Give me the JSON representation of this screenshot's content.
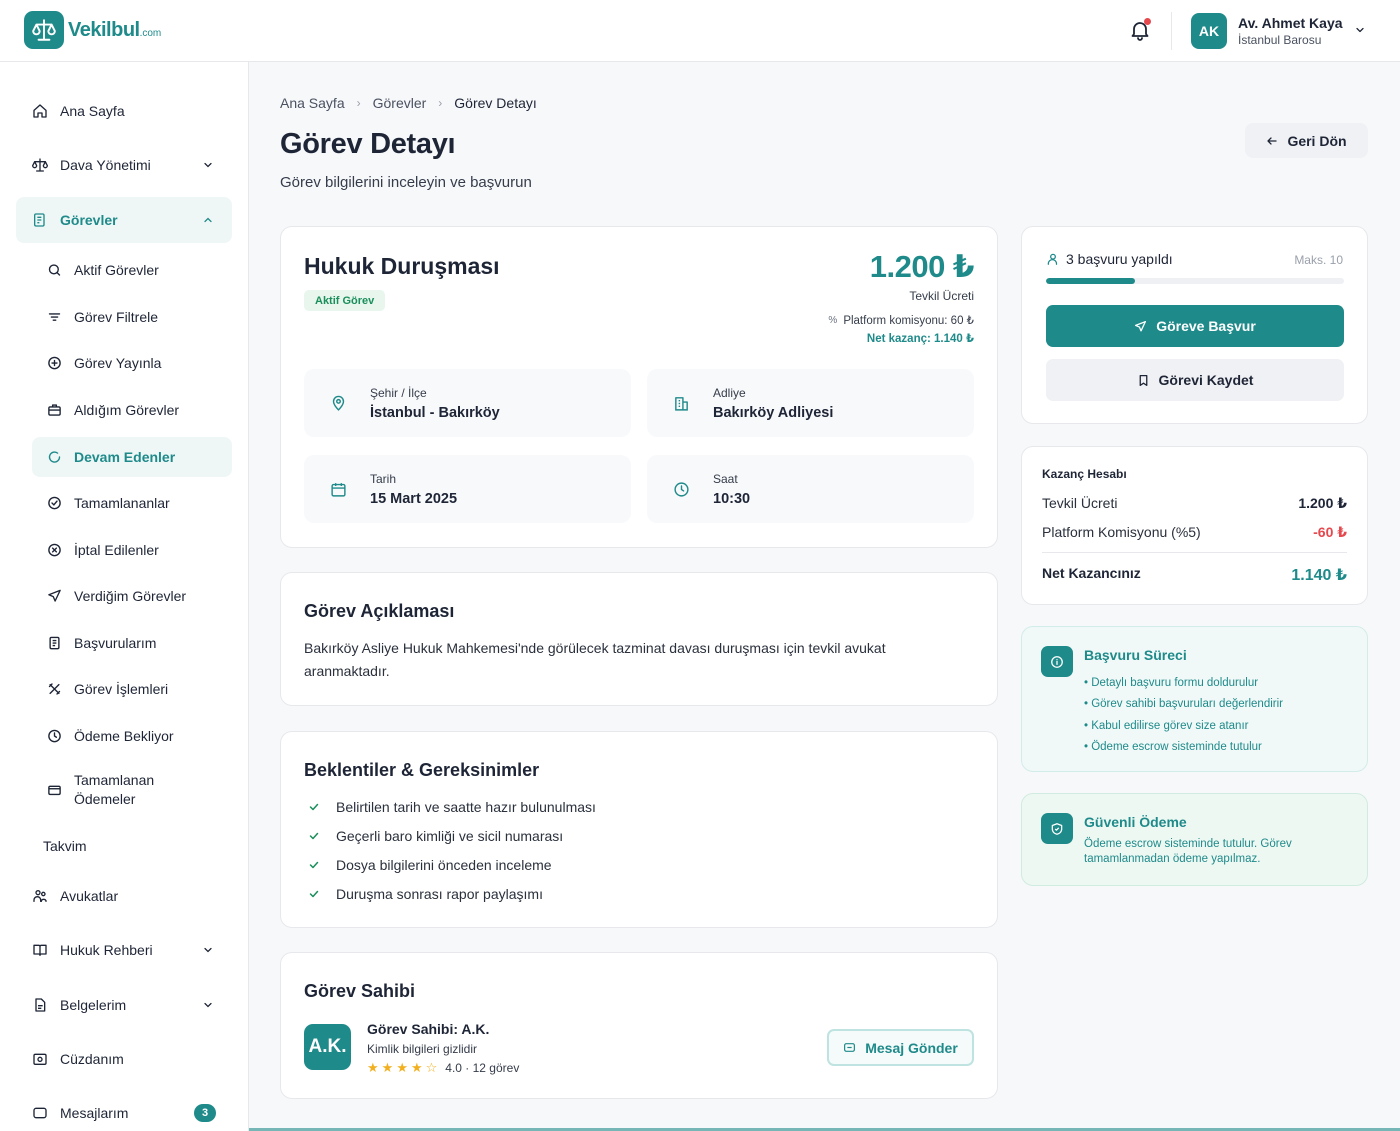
{
  "brand": {
    "name": "Vekilbul",
    "suffix": ".com"
  },
  "header": {
    "user_initials": "AK",
    "user_name": "Av. Ahmet Kaya",
    "user_org": "İstanbul Barosu"
  },
  "sidebar": {
    "items": [
      {
        "label": "Ana Sayfa"
      },
      {
        "label": "Dava Yönetimi"
      },
      {
        "label": "Görevler"
      },
      {
        "label": "Takvim"
      },
      {
        "label": "Avukatlar"
      },
      {
        "label": "Hukuk Rehberi"
      },
      {
        "label": "Belgelerim"
      },
      {
        "label": "Cüzdanım"
      },
      {
        "label": "Mesajlarım",
        "badge": "3"
      }
    ],
    "sub_items": [
      {
        "label": "Aktif Görevler"
      },
      {
        "label": "Görev Filtrele"
      },
      {
        "label": "Görev Yayınla"
      },
      {
        "label": "Aldığım Görevler"
      },
      {
        "label": "Devam Edenler"
      },
      {
        "label": "Tamamlananlar"
      },
      {
        "label": "İptal Edilenler"
      },
      {
        "label": "Verdiğim Görevler"
      },
      {
        "label": "Başvurularım"
      },
      {
        "label": "Görev İşlemleri"
      },
      {
        "label": "Ödeme Bekliyor"
      },
      {
        "label": "Tamamlanan Ödemeler"
      }
    ]
  },
  "breadcrumb": [
    "Ana Sayfa",
    "Görevler",
    "Görev Detayı"
  ],
  "page": {
    "title": "Görev Detayı",
    "subtitle": "Görev bilgilerini inceleyin ve başvurun",
    "back_label": "Geri Dön"
  },
  "job": {
    "title": "Hukuk Duruşması",
    "status": "Aktif Görev",
    "price": "1.200 ₺",
    "price_label": "Tevkil Ücreti",
    "commission": "Platform komisyonu: 60 ₺",
    "net": "Net kazanç: 1.140 ₺",
    "info": [
      {
        "key": "Şehir / İlçe",
        "value": "İstanbul - Bakırköy"
      },
      {
        "key": "Adliye",
        "value": "Bakırköy Adliyesi"
      },
      {
        "key": "Tarih",
        "value": "15 Mart 2025"
      },
      {
        "key": "Saat",
        "value": "10:30"
      }
    ]
  },
  "description": {
    "title": "Görev Açıklaması",
    "text": "Bakırköy Asliye Hukuk Mahkemesi'nde görülecek tazminat davası duruşması için tevkil avukat aranmaktadır."
  },
  "requirements": {
    "title": "Beklentiler & Gereksinimler",
    "items": [
      "Belirtilen tarih ve saatte hazır bulunulması",
      "Geçerli baro kimliği ve sicil numarası",
      "Dosya bilgilerini önceden inceleme",
      "Duruşma sonrası rapor paylaşımı"
    ]
  },
  "owner": {
    "title": "Görev Sahibi",
    "initials": "A.K.",
    "name": "Görev Sahibi: A.K.",
    "hidden": "Kimlik bilgileri gizlidir",
    "rating_text": "4.0 · 12 görev",
    "rating": 4.0,
    "message_label": "Mesaj Gönder"
  },
  "application": {
    "count_text": "3 başvuru yapıldı",
    "max_text": "Maks. 10",
    "progress_fraction": 0.3,
    "apply_label": "Göreve Başvur",
    "save_label": "Görevi Kaydet"
  },
  "calc": {
    "title": "Kazanç Hesabı",
    "fee_label": "Tevkil Ücreti",
    "fee_value": "1.200 ₺",
    "comm_label": "Platform Komisyonu (%5)",
    "comm_value": "-60 ₺",
    "net_label": "Net Kazancınız",
    "net_value": "1.140 ₺"
  },
  "process": {
    "title": "Başvuru Süreci",
    "items": [
      "• Detaylı başvuru formu doldurulur",
      "• Görev sahibi başvuruları değerlendirir",
      "• Kabul edilirse görev size atanır",
      "• Ödeme escrow sisteminde tutulur"
    ]
  },
  "secure": {
    "title": "Güvenli Ödeme",
    "text": "Ödeme escrow sisteminde tutulur. Görev tamamlanmadan ödeme yapılmaz."
  },
  "colors": {
    "accent": "#1f8a8a",
    "danger": "#e5484d",
    "success": "#1a8f5a"
  }
}
